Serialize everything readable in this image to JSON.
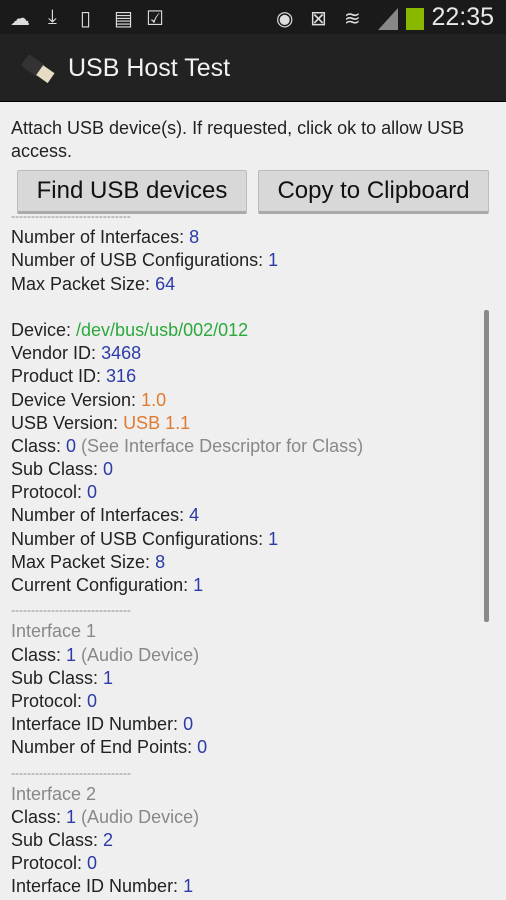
{
  "status_bar": {
    "time": "22:35",
    "icons": [
      "cloud-upload-icon",
      "download-icon",
      "phone-transfer-icon",
      "sim-icon",
      "shopping-bag-check-icon",
      "eye-icon",
      "mute-vibrate-icon",
      "wifi-icon",
      "signal-icon",
      "battery-icon"
    ],
    "battery_color": "#8ab800"
  },
  "app_bar": {
    "title": "USB Host Test",
    "logo": "usb-plug-icon"
  },
  "intro": "Attach USB device(s).  If requested, click ok to allow USB access.",
  "buttons": {
    "find": "Find USB devices",
    "copy": "Copy to Clipboard"
  },
  "colors": {
    "value": "#2b3aa8",
    "device": "#2ca83c",
    "version": "#e07a30",
    "note": "#888888",
    "label": "#222222"
  },
  "lines": [
    [
      {
        "t": "------------------------------",
        "c": "note"
      }
    ],
    [
      {
        "t": "Number of Interfaces: ",
        "c": "label"
      },
      {
        "t": "8",
        "c": "value"
      }
    ],
    [
      {
        "t": "Number of USB Configurations: ",
        "c": "label"
      },
      {
        "t": "1",
        "c": "value"
      }
    ],
    [
      {
        "t": "Max Packet Size: ",
        "c": "label"
      },
      {
        "t": "64",
        "c": "value"
      }
    ],
    [],
    [
      {
        "t": "Device: ",
        "c": "label"
      },
      {
        "t": "/dev/bus/usb/002/012",
        "c": "device"
      }
    ],
    [
      {
        "t": "Vendor ID: ",
        "c": "label"
      },
      {
        "t": "3468",
        "c": "value"
      }
    ],
    [
      {
        "t": "Product ID: ",
        "c": "label"
      },
      {
        "t": "316",
        "c": "value"
      }
    ],
    [
      {
        "t": "Device Version: ",
        "c": "label"
      },
      {
        "t": "1.0",
        "c": "version"
      }
    ],
    [
      {
        "t": "USB Version: ",
        "c": "label"
      },
      {
        "t": "USB 1.1",
        "c": "version"
      }
    ],
    [
      {
        "t": "Class: ",
        "c": "label"
      },
      {
        "t": "0",
        "c": "value"
      },
      {
        "t": " (See Interface Descriptor for Class)",
        "c": "note"
      }
    ],
    [
      {
        "t": "Sub Class: ",
        "c": "label"
      },
      {
        "t": "0",
        "c": "value"
      }
    ],
    [
      {
        "t": "Protocol: ",
        "c": "label"
      },
      {
        "t": "0",
        "c": "value"
      }
    ],
    [
      {
        "t": "Number of Interfaces: ",
        "c": "label"
      },
      {
        "t": "4",
        "c": "value"
      }
    ],
    [
      {
        "t": "Number of USB Configurations: ",
        "c": "label"
      },
      {
        "t": "1",
        "c": "value"
      }
    ],
    [
      {
        "t": "Max Packet Size: ",
        "c": "label"
      },
      {
        "t": "8",
        "c": "value"
      }
    ],
    [
      {
        "t": "Current Configuration: ",
        "c": "label"
      },
      {
        "t": "1",
        "c": "value"
      }
    ],
    [
      {
        "t": "------------------------------",
        "c": "note"
      }
    ],
    [
      {
        "t": "Interface 1",
        "c": "note"
      }
    ],
    [
      {
        "t": "Class: ",
        "c": "label"
      },
      {
        "t": "1",
        "c": "value"
      },
      {
        "t": " (Audio Device)",
        "c": "note"
      }
    ],
    [
      {
        "t": "Sub Class: ",
        "c": "label"
      },
      {
        "t": "1",
        "c": "value"
      }
    ],
    [
      {
        "t": "Protocol: ",
        "c": "label"
      },
      {
        "t": "0",
        "c": "value"
      }
    ],
    [
      {
        "t": "Interface ID Number: ",
        "c": "label"
      },
      {
        "t": "0",
        "c": "value"
      }
    ],
    [
      {
        "t": "Number of End Points: ",
        "c": "label"
      },
      {
        "t": "0",
        "c": "value"
      }
    ],
    [
      {
        "t": "------------------------------",
        "c": "note"
      }
    ],
    [
      {
        "t": "Interface 2",
        "c": "note"
      }
    ],
    [
      {
        "t": "Class: ",
        "c": "label"
      },
      {
        "t": "1",
        "c": "value"
      },
      {
        "t": " (Audio Device)",
        "c": "note"
      }
    ],
    [
      {
        "t": "Sub Class: ",
        "c": "label"
      },
      {
        "t": "2",
        "c": "value"
      }
    ],
    [
      {
        "t": "Protocol: ",
        "c": "label"
      },
      {
        "t": "0",
        "c": "value"
      }
    ],
    [
      {
        "t": "Interface ID Number: ",
        "c": "label"
      },
      {
        "t": "1",
        "c": "value"
      }
    ]
  ]
}
